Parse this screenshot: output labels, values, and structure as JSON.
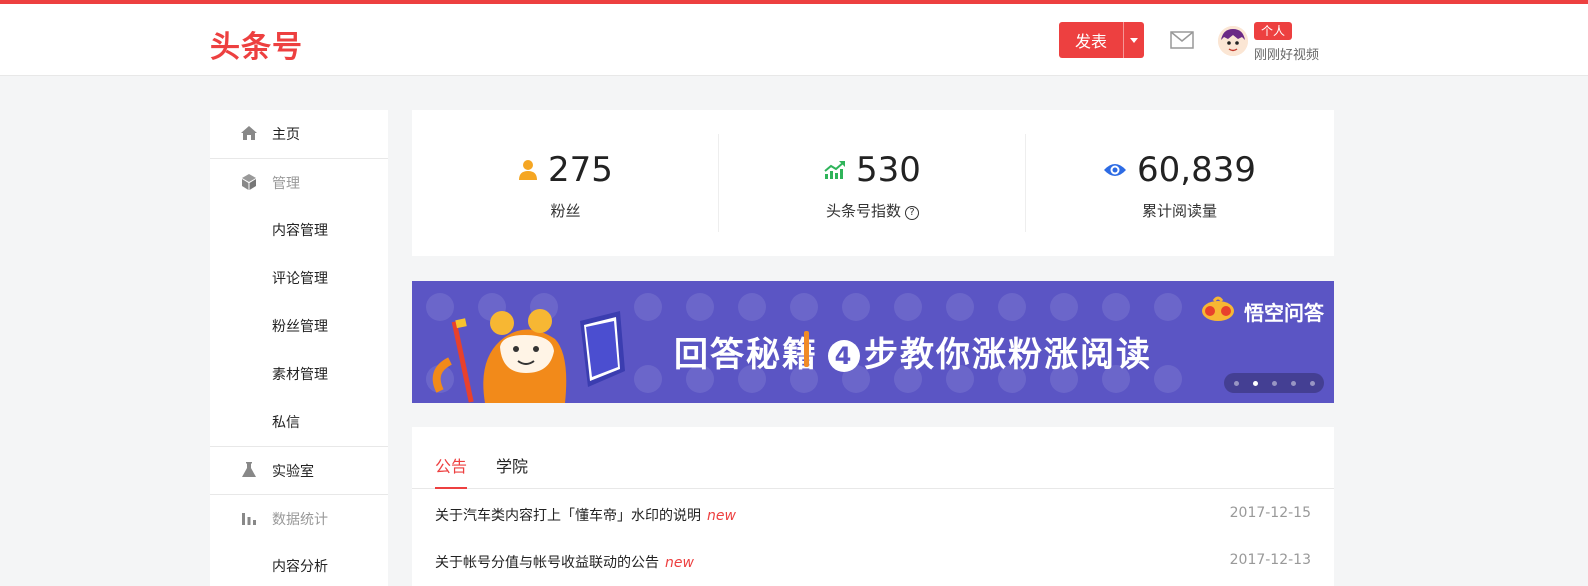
{
  "header": {
    "logo": "头条号",
    "publish_label": "发表",
    "badge": "个人",
    "username": "刚刚好视频"
  },
  "sidebar": {
    "items": [
      {
        "label": "主页",
        "icon": "home-icon"
      },
      {
        "label": "管理",
        "icon": "cube-icon"
      },
      {
        "label": "内容管理"
      },
      {
        "label": "评论管理"
      },
      {
        "label": "粉丝管理"
      },
      {
        "label": "素材管理"
      },
      {
        "label": "私信"
      },
      {
        "label": "实验室",
        "icon": "flask-icon"
      },
      {
        "label": "数据统计",
        "icon": "bar-chart-icon"
      },
      {
        "label": "内容分析"
      }
    ]
  },
  "stats": [
    {
      "value": "275",
      "label": "粉丝",
      "icon": "user-icon",
      "color": "#f5a623"
    },
    {
      "value": "530",
      "label": "头条号指数",
      "icon": "trend-up-icon",
      "color": "#2fb45a"
    },
    {
      "value": "60,839",
      "label": "累计阅读量",
      "icon": "eye-icon",
      "color": "#2d6be4"
    }
  ],
  "banner": {
    "title": "回答秘籍",
    "step_number": "4",
    "subtitle": "步教你涨粉涨阅读",
    "brand": "悟空问答",
    "slide_count": 5,
    "active_slide": 1
  },
  "notice": {
    "tabs": [
      "公告",
      "学院"
    ],
    "active_tab": 0,
    "new_label": "new",
    "items": [
      {
        "title": "关于汽车类内容打上「懂车帝」水印的说明",
        "date": "2017-12-15"
      },
      {
        "title": "关于帐号分值与帐号收益联动的公告",
        "date": "2017-12-13"
      }
    ]
  },
  "colors": {
    "accent": "#ed4040",
    "banner_bg": "#5b55c4"
  }
}
